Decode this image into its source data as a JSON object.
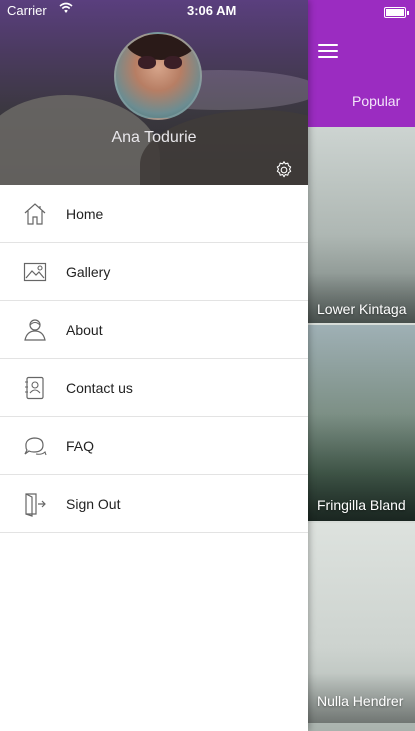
{
  "status_bar": {
    "carrier": "Carrier",
    "time": "3:06 AM"
  },
  "profile": {
    "name": "Ana Todurie"
  },
  "menu": {
    "items": [
      {
        "label": "Home",
        "icon": "home-icon"
      },
      {
        "label": "Gallery",
        "icon": "gallery-icon"
      },
      {
        "label": "About",
        "icon": "about-icon"
      },
      {
        "label": "Contact us",
        "icon": "contact-icon"
      },
      {
        "label": "FAQ",
        "icon": "faq-icon"
      },
      {
        "label": "Sign Out",
        "icon": "sign-out-icon"
      }
    ]
  },
  "content": {
    "tab_label": "Popular",
    "cards": [
      {
        "title": "Lower Kintaga"
      },
      {
        "title": "Fringilla Bland"
      },
      {
        "title": "Nulla Hendrer"
      }
    ]
  },
  "colors": {
    "accent": "#9b2cc1",
    "header_dark": "#2a2a2a",
    "divider": "#e3e3e3"
  }
}
